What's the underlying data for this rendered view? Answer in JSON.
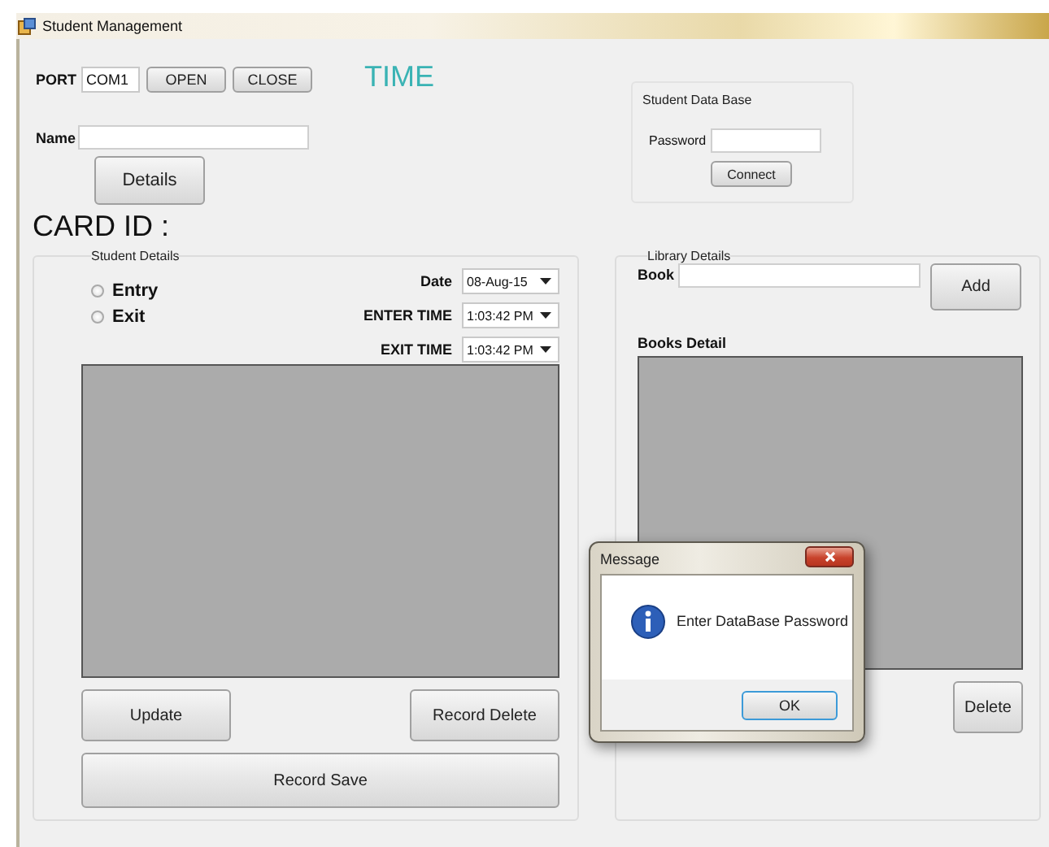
{
  "window": {
    "title": "Student Management"
  },
  "port": {
    "label": "PORT",
    "value": "COM1"
  },
  "port_buttons": [
    "OPEN",
    "CLOSE"
  ],
  "time_label": "TIME",
  "name_field": {
    "label": "Name"
  },
  "details_button": "Details",
  "database": {
    "title": "Student Data Base",
    "password_label": "Password",
    "connect_button": "Connect"
  },
  "card_id": "CARD ID :",
  "student_details": {
    "title": "Student Details",
    "options": [
      {
        "label": "Entry",
        "selected": false
      },
      {
        "label": "Exit",
        "selected": false
      }
    ],
    "pickers": [
      {
        "label": "Date",
        "value": "08-Aug-15"
      },
      {
        "label": "ENTER TIME",
        "value": "1:03:42 PM"
      },
      {
        "label": "EXIT TIME",
        "value": "1:03:42 PM"
      }
    ],
    "buttons": [
      "Update",
      "Record Delete",
      "Record Save"
    ]
  },
  "library": {
    "title": "Library Details",
    "book_label": "Book",
    "add_button": "Add",
    "books_label": "Books Detail",
    "delete_button": "Delete"
  },
  "dialog": {
    "title": "Message",
    "message": "Enter DataBase Password",
    "button": "OK"
  }
}
